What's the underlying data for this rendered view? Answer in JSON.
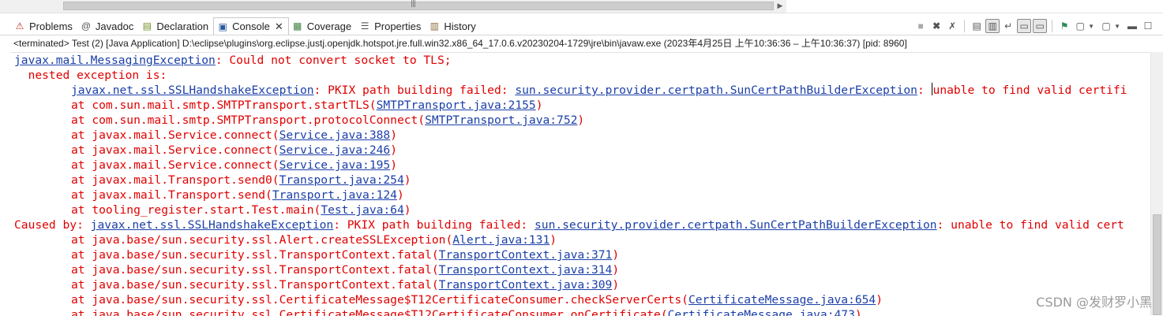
{
  "tabs": [
    {
      "label": "Problems",
      "icon": "problems-icon",
      "active": false
    },
    {
      "label": "Javadoc",
      "icon": "javadoc-icon",
      "active": false
    },
    {
      "label": "Declaration",
      "icon": "declaration-icon",
      "active": false
    },
    {
      "label": "Console",
      "icon": "console-icon",
      "active": true,
      "close": "✕"
    },
    {
      "label": "Coverage",
      "icon": "coverage-icon",
      "active": false
    },
    {
      "label": "Properties",
      "icon": "properties-icon",
      "active": false
    },
    {
      "label": "History",
      "icon": "history-icon",
      "active": false
    }
  ],
  "status": "<terminated> Test (2) [Java Application] D:\\eclipse\\plugins\\org.eclipse.justj.openjdk.hotspot.jre.full.win32.x86_64_17.0.6.v20230204-1729\\jre\\bin\\javaw.exe  (2023年4月25日 上午10:36:36 – 上午10:36:37) [pid: 8960]",
  "console": {
    "line1_link": "javax.mail.MessagingException",
    "line1_rest": ": Could not convert socket to TLS;",
    "line2": "  nested exception is:",
    "line3_link1": "javax.net.ssl.SSLHandshakeException",
    "line3_mid": ": PKIX path building failed: ",
    "line3_link2": "sun.security.provider.certpath.SunCertPathBuilderException",
    "line3_rest": ": unable to find valid certifi",
    "frames1": [
      {
        "text": "at com.sun.mail.smtp.SMTPTransport.startTLS(",
        "link": "SMTPTransport.java:2155"
      },
      {
        "text": "at com.sun.mail.smtp.SMTPTransport.protocolConnect(",
        "link": "SMTPTransport.java:752"
      },
      {
        "text": "at javax.mail.Service.connect(",
        "link": "Service.java:388"
      },
      {
        "text": "at javax.mail.Service.connect(",
        "link": "Service.java:246"
      },
      {
        "text": "at javax.mail.Service.connect(",
        "link": "Service.java:195"
      },
      {
        "text": "at javax.mail.Transport.send0(",
        "link": "Transport.java:254"
      },
      {
        "text": "at javax.mail.Transport.send(",
        "link": "Transport.java:124"
      },
      {
        "text": "at tooling_register.start.Test.main(",
        "link": "Test.java:64"
      }
    ],
    "caused_prefix": "Caused by: ",
    "caused_link1": "javax.net.ssl.SSLHandshakeException",
    "caused_mid": ": PKIX path building failed: ",
    "caused_link2": "sun.security.provider.certpath.SunCertPathBuilderException",
    "caused_rest": ": unable to find valid cert",
    "frames2": [
      {
        "text": "at java.base/sun.security.ssl.Alert.createSSLException(",
        "link": "Alert.java:131"
      },
      {
        "text": "at java.base/sun.security.ssl.TransportContext.fatal(",
        "link": "TransportContext.java:371"
      },
      {
        "text": "at java.base/sun.security.ssl.TransportContext.fatal(",
        "link": "TransportContext.java:314"
      },
      {
        "text": "at java.base/sun.security.ssl.TransportContext.fatal(",
        "link": "TransportContext.java:309"
      },
      {
        "text": "at java.base/sun.security.ssl.CertificateMessage$T12CertificateConsumer.checkServerCerts(",
        "link": "CertificateMessage.java:654"
      },
      {
        "text": "at java.base/sun.security.ssl.CertificateMessage$T12CertificateConsumer.onCertificate(",
        "link": "CertificateMessage.java:473"
      }
    ],
    "close_paren": ")"
  },
  "watermark": "CSDN @发财罗小黑",
  "colors": {
    "error": "#e00000",
    "link": "#1b3fa8"
  }
}
